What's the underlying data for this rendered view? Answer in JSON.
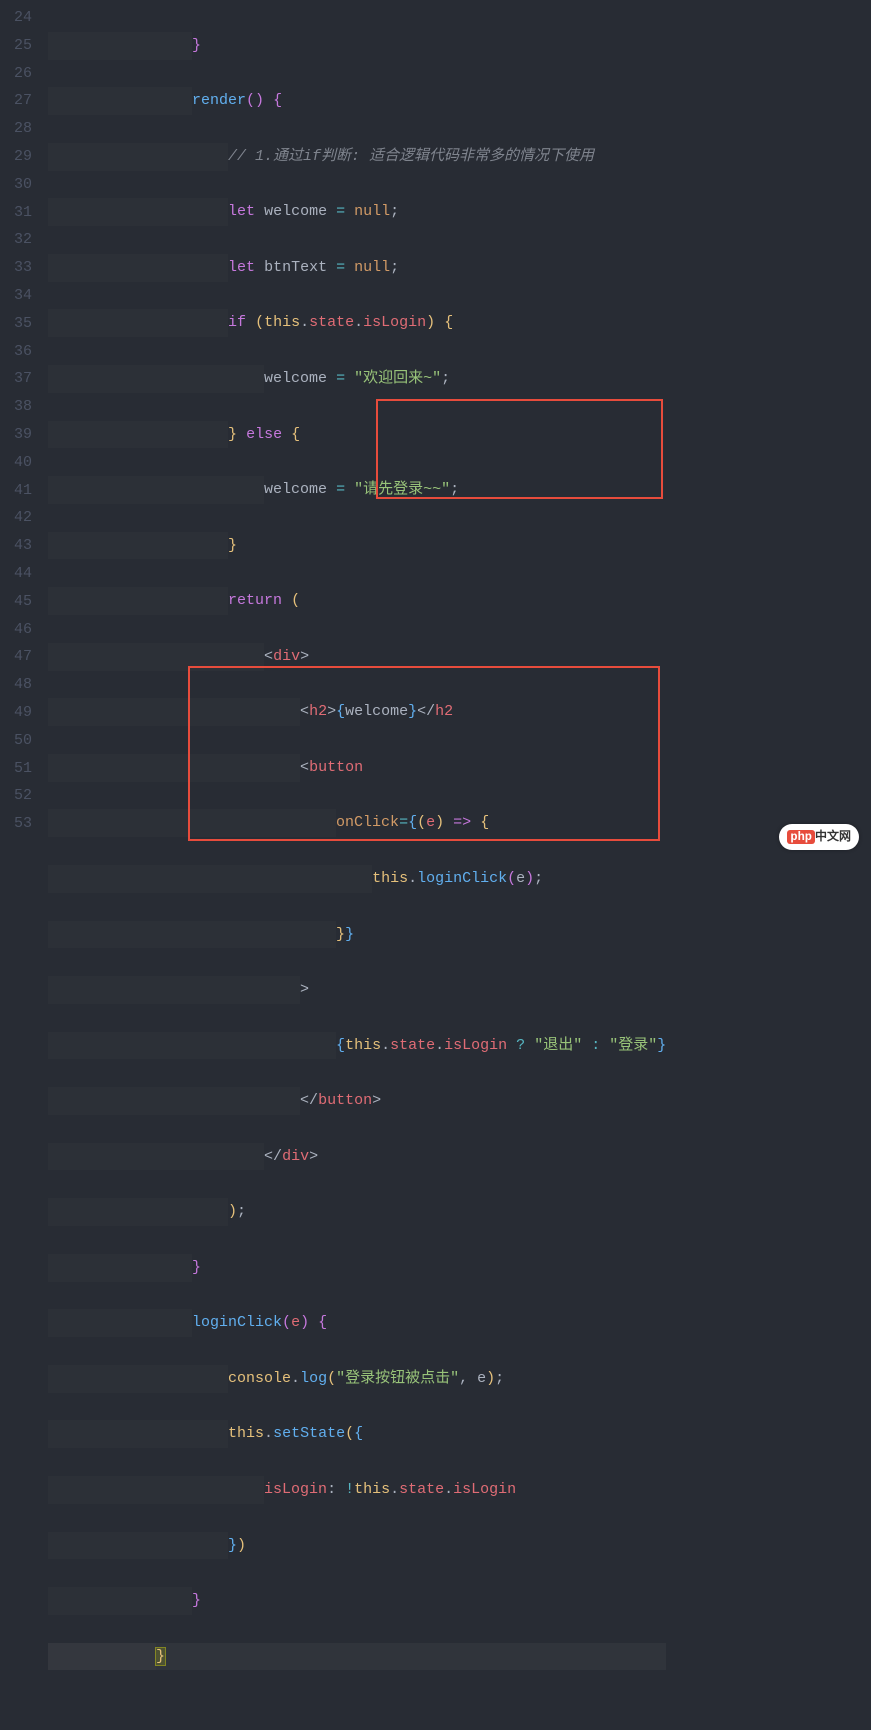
{
  "lines": {
    "start": 24,
    "end": 53
  },
  "code": {
    "l24": "}",
    "render": "render",
    "comment": "// 1.通过if判断: 适合逻辑代码非常多的情况下使用",
    "let": "let",
    "welcome": "welcome",
    "btnText": "btnText",
    "nullish": "null",
    "if": "if",
    "this": "this",
    "state": "state",
    "isLogin": "isLogin",
    "str_welcome_back": "\"欢迎回来~\"",
    "else": "else",
    "str_please_login": "\"请先登录~~\"",
    "return": "return",
    "div": "div",
    "h2": "h2",
    "button": "button",
    "onClick": "onClick",
    "e": "e",
    "loginClick": "loginClick",
    "str_logout": "\"退出\"",
    "str_login": "\"登录\"",
    "console": "console",
    "log": "log",
    "str_btn_clicked": "\"登录按钮被点击\"",
    "setState": "setState"
  },
  "logo": {
    "brand": "php",
    "suffix": "中文网"
  }
}
